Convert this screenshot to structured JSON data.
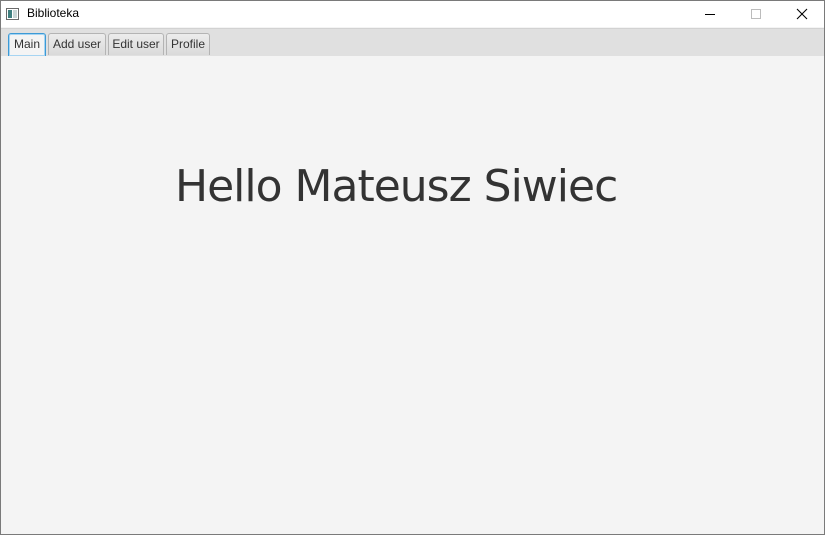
{
  "window": {
    "title": "Biblioteka",
    "app_icon": "window-app-icon",
    "controls": {
      "minimize_icon": "minimize-icon",
      "maximize_icon": "maximize-icon",
      "close_icon": "close-icon"
    }
  },
  "tabs": [
    {
      "label": "Main",
      "active": true
    },
    {
      "label": "Add user",
      "active": false
    },
    {
      "label": "Edit user",
      "active": false
    },
    {
      "label": "Profile",
      "active": false
    }
  ],
  "main": {
    "greeting": "Hello Mateusz Siwiec"
  },
  "colors": {
    "background": "#f4f4f4",
    "tab_active_border": "#3c9ad6",
    "text": "#333333"
  }
}
